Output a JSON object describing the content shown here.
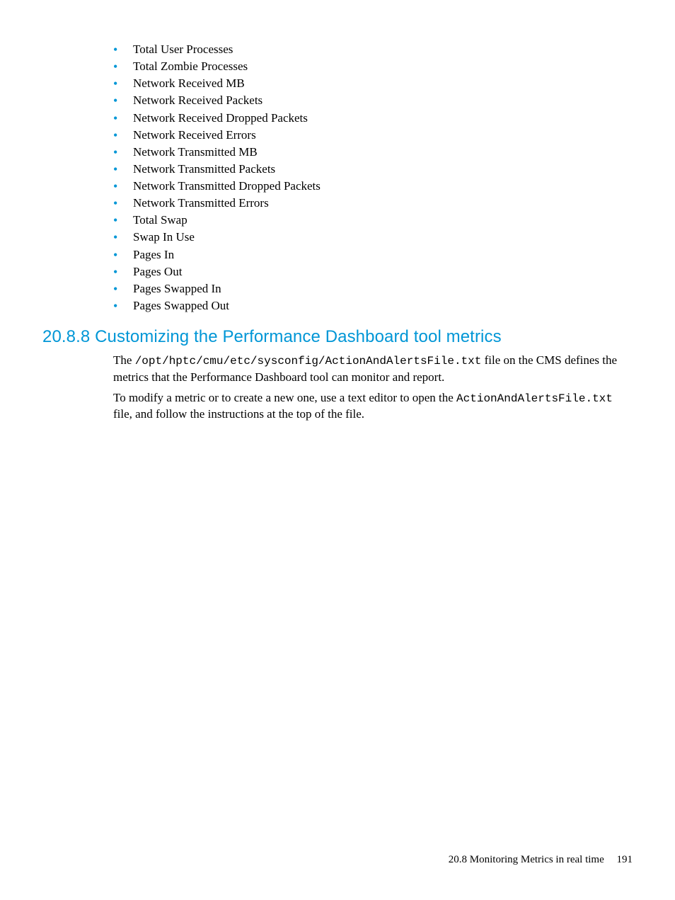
{
  "metrics_list": [
    "Total User Processes",
    "Total Zombie Processes",
    "Network Received MB",
    "Network Received Packets",
    "Network Received Dropped Packets",
    "Network Received Errors",
    "Network Transmitted MB",
    "Network Transmitted Packets",
    "Network Transmitted Dropped Packets",
    "Network Transmitted Errors",
    "Total Swap",
    "Swap In Use",
    "Pages In",
    "Pages Out",
    "Pages Swapped In",
    "Pages Swapped Out"
  ],
  "section": {
    "heading": "20.8.8 Customizing the Performance Dashboard tool metrics",
    "para1_part1": "The ",
    "para1_code1": "/opt/hptc/cmu/etc/sysconfig/ActionAndAlertsFile.txt",
    "para1_part2": " file on the CMS defines the metrics that the Performance Dashboard tool can monitor and report.",
    "para2_part1": "To modify a metric or to create a new one, use a text editor to open the ",
    "para2_code1": "ActionAndAlertsFile.txt",
    "para2_part2": " file, and follow the instructions at the top of the file."
  },
  "footer": {
    "label": "20.8 Monitoring Metrics in real time",
    "page": "191"
  }
}
